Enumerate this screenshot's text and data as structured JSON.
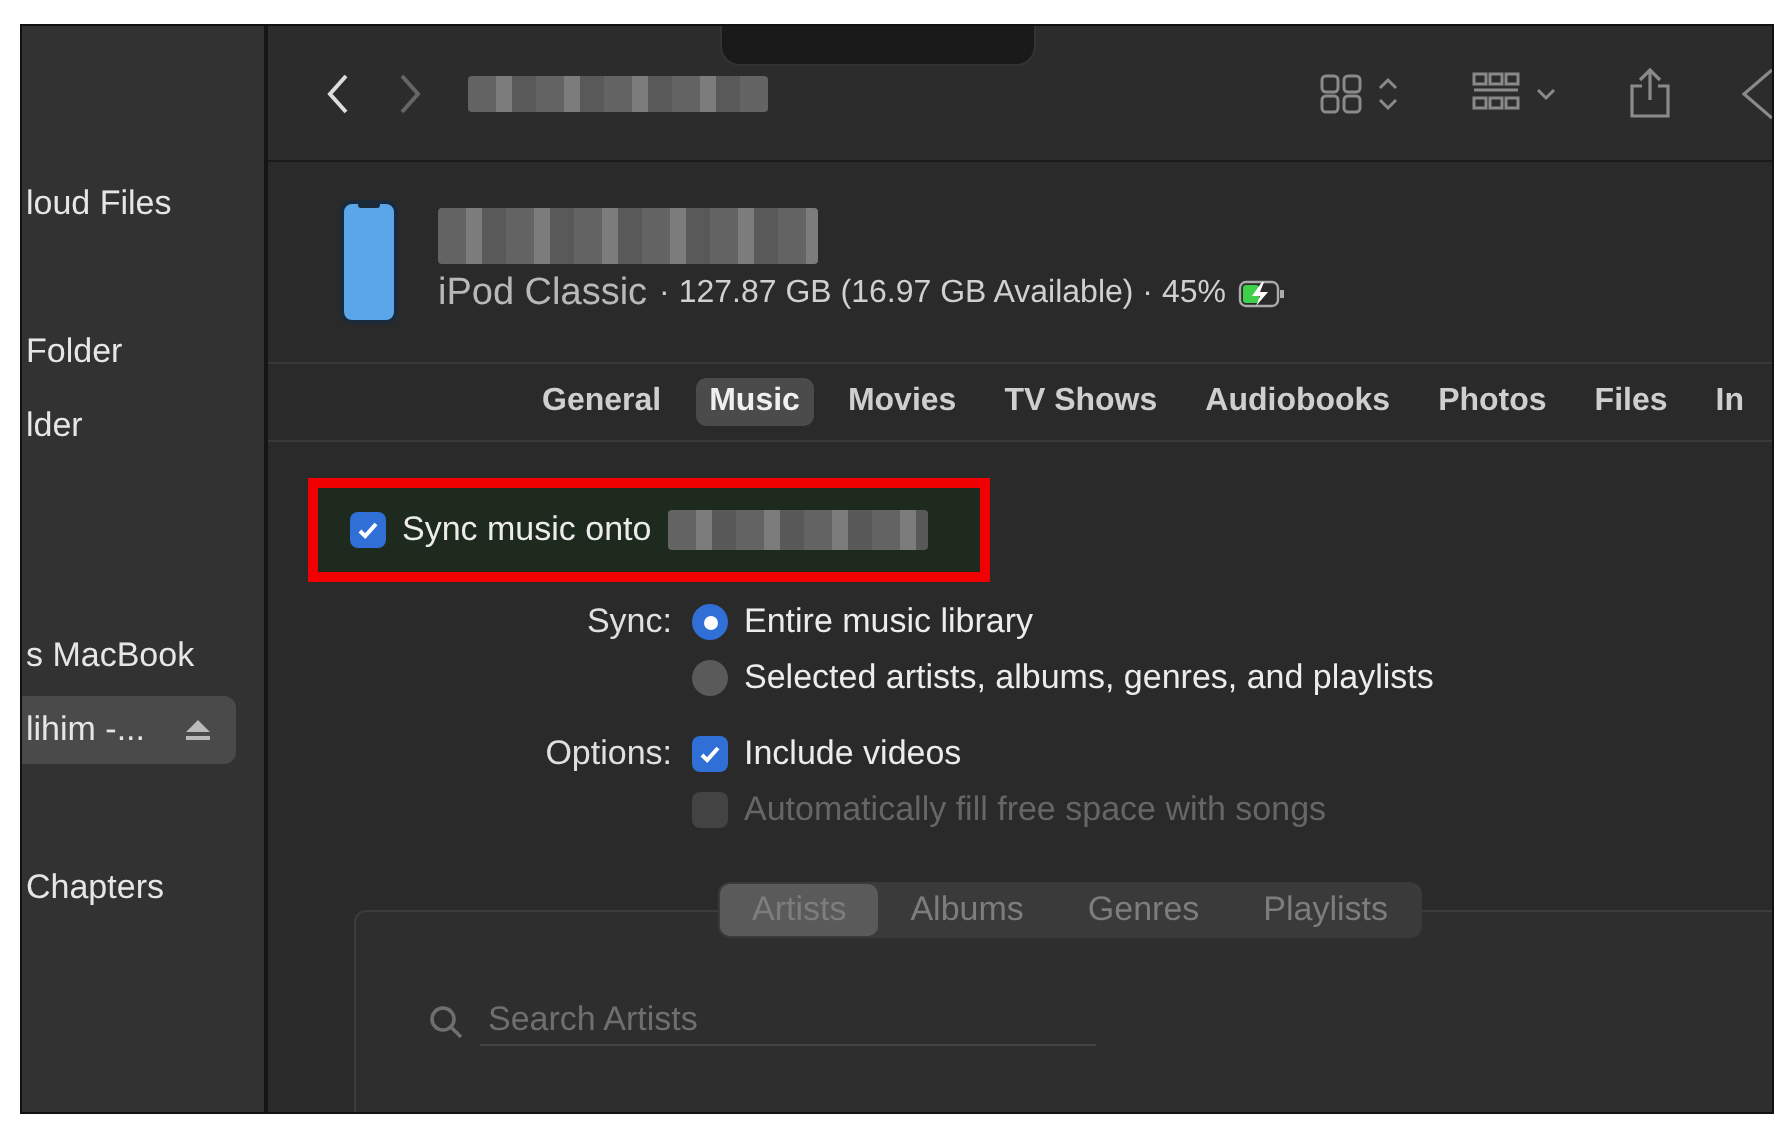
{
  "sidebar": {
    "items": [
      {
        "label": "loud Files",
        "selected": false,
        "ejectable": false
      },
      {
        "label": "Folder",
        "selected": false,
        "ejectable": false
      },
      {
        "label": "lder",
        "selected": false,
        "ejectable": false
      },
      {
        "label": "s MacBook",
        "selected": false,
        "ejectable": false
      },
      {
        "label": "lihim -...",
        "selected": true,
        "ejectable": true
      },
      {
        "label": "Chapters",
        "selected": false,
        "ejectable": false
      }
    ]
  },
  "device": {
    "model": "iPod Classic",
    "details": "· 127.87 GB (16.97 GB Available) · 45%",
    "charging": true
  },
  "tabs": [
    {
      "label": "General",
      "selected": false
    },
    {
      "label": "Music",
      "selected": true
    },
    {
      "label": "Movies",
      "selected": false
    },
    {
      "label": "TV Shows",
      "selected": false
    },
    {
      "label": "Audiobooks",
      "selected": false
    },
    {
      "label": "Photos",
      "selected": false
    },
    {
      "label": "Files",
      "selected": false
    },
    {
      "label": "In",
      "selected": false
    }
  ],
  "sync_toggle": {
    "label": "Sync music onto",
    "checked": true
  },
  "sync": {
    "label": "Sync:",
    "options": [
      {
        "label": "Entire music library",
        "selected": true
      },
      {
        "label": "Selected artists, albums, genres, and playlists",
        "selected": false
      }
    ]
  },
  "options": {
    "label": "Options:",
    "items": [
      {
        "label": "Include videos",
        "checked": true,
        "disabled": false
      },
      {
        "label": "Automatically fill free space with songs",
        "checked": false,
        "disabled": true
      }
    ]
  },
  "segments": [
    {
      "label": "Artists",
      "selected": true
    },
    {
      "label": "Albums",
      "selected": false
    },
    {
      "label": "Genres",
      "selected": false
    },
    {
      "label": "Playlists",
      "selected": false
    }
  ],
  "search": {
    "placeholder": "Search Artists"
  }
}
